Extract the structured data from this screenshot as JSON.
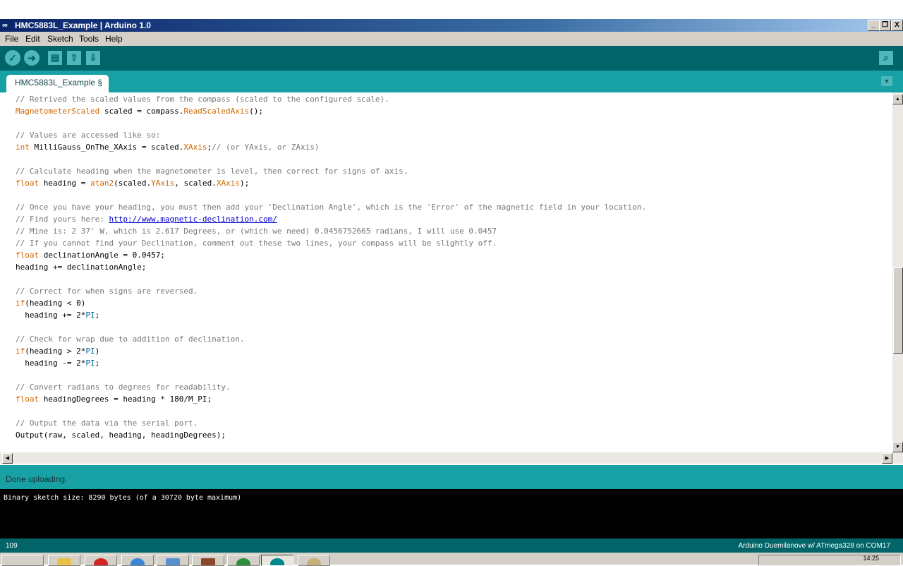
{
  "window": {
    "title": "HMC5883L_Example | Arduino 1.0",
    "logo_glyph": "∞",
    "controls": {
      "minimize": "_",
      "restore": "❐",
      "close": "X"
    }
  },
  "menu": [
    "File",
    "Edit",
    "Sketch",
    "Tools",
    "Help"
  ],
  "toolbar": {
    "buttons": [
      {
        "icon": "verify-check-icon",
        "glyph": "✓"
      },
      {
        "icon": "upload-arrow-icon",
        "glyph": "➜"
      },
      {
        "icon": "new-file-icon",
        "glyph": "▤"
      },
      {
        "icon": "open-arrow-up-icon",
        "glyph": "⇧"
      },
      {
        "icon": "save-arrow-down-icon",
        "glyph": "⇩"
      }
    ],
    "serial_monitor": {
      "icon": "serial-monitor-icon",
      "glyph": "⌕"
    }
  },
  "tab": {
    "label": "HMC5883L_Example §",
    "menu_glyph": "▼"
  },
  "editor": {
    "lines": [
      "// Retrived the scaled values from the compass (scaled to the configured scale).",
      "MagnetometerScaled scaled = compass.ReadScaledAxis();",
      "",
      "// Values are accessed like so:",
      "int MilliGauss_OnThe_XAxis = scaled.XAxis;// (or YAxis, or ZAxis)",
      "",
      "// Calculate heading when the magnetometer is level, then correct for signs of axis.",
      "float heading = atan2(scaled.YAxis, scaled.XAxis);",
      "",
      "// Once you have your heading, you must then add your 'Declination Angle', which is the 'Error' of the magnetic field in your location.",
      "// Find yours here: http://www.magnetic-declination.com/",
      "// Mine is: 2\u0000 37' W, which is 2.617 Degrees, or (which we need) 0.0456752665 radians, I will use 0.0457",
      "// If you cannot find your Declination, comment out these two lines, your compass will be slightly off.",
      "float declinationAngle = 0.0457;",
      "heading += declinationAngle;",
      "",
      "// Correct for when signs are reversed.",
      "if(heading < 0)",
      "  heading += 2*PI;",
      "",
      "// Check for wrap due to addition of declination.",
      "if(heading > 2*PI)",
      "  heading -= 2*PI;",
      "",
      "// Convert radians to degrees for readability.",
      "float headingDegrees = heading * 180/M_PI;",
      "",
      "// Output the data via the serial port.",
      "Output(raw, scaled, heading, headingDegrees);"
    ],
    "link_url": "http://www.magnetic-declination.com/"
  },
  "status": {
    "message": "Done uploading."
  },
  "console": {
    "text": "Binary sketch size: 8290 bytes (of a 30720 byte maximum)"
  },
  "bottom": {
    "line_number": "109",
    "board": "Arduino Duemilanove w/ ATmega328 on COM17"
  },
  "taskbar": {
    "clock": "14:25"
  },
  "colors": {
    "toolbar": "#006468",
    "tabstrip": "#17a1a5",
    "comment": "#777777",
    "keyword": "#cc6600",
    "constant": "#006699",
    "link": "#0000cc"
  }
}
